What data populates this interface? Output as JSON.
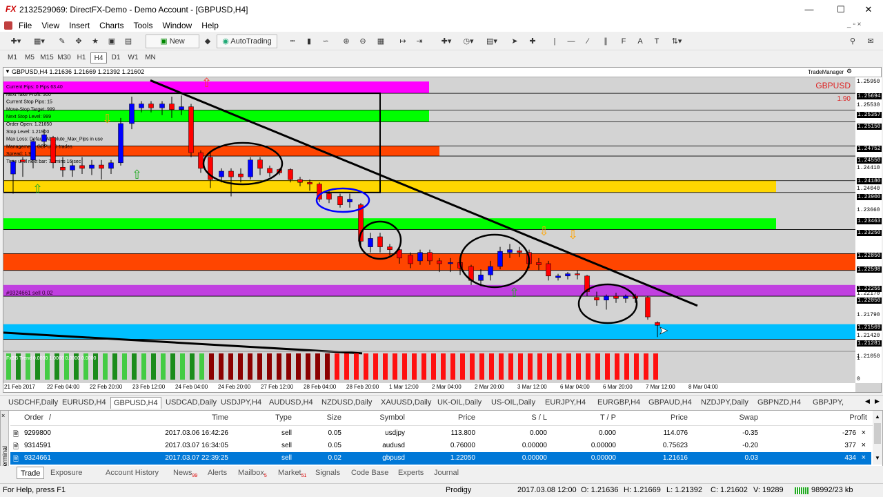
{
  "window": {
    "app_logo": "FX",
    "title": "2132529069: DirectFX-Demo - Demo Account - [GBPUSD,H4]"
  },
  "menu": [
    "File",
    "View",
    "Insert",
    "Charts",
    "Tools",
    "Window",
    "Help"
  ],
  "toolbar": {
    "new_order": "New Order",
    "auto_trading": "AutoTrading"
  },
  "timeframes": [
    "M1",
    "M5",
    "M15",
    "M30",
    "H1",
    "H4",
    "D1",
    "W1",
    "MN"
  ],
  "timeframe_selected": "H4",
  "chart": {
    "header": "GBPUSD,H4  1.21636 1.21669 1.21392 1.21602",
    "symbol_label": "GBPUSD",
    "spread_value": "1.90",
    "trade_manager": "TradeManager",
    "position_label": "#9324661 sell 0.02",
    "indicator_label": "FxBB Trend 0.0000 1.0000 0.0000 0.0000",
    "indicator_scale": [
      "1",
      "0"
    ],
    "overlay_lines": [
      "Current Pips: 0 Pips 63.40",
      "Next Take Profit: 300",
      "Current Stop Pips: 15",
      "Move-Stop Target: 999",
      "Next Stop Level: 999",
      "Order Open: 1.21650",
      "Stop Level: 1.21900",
      "Max Loss: Default Absolute_Max_Pips in use",
      "Management: GBPUSD trades",
      "Spread: 1.90",
      "Time until next bar: 78 mins 16 sec"
    ],
    "price_labels": [
      "1.25950",
      "1.25694",
      "1.25530",
      "1.25357",
      "1.25150",
      "1.24752",
      "1.24550",
      "1.24410",
      "1.24180",
      "1.24040",
      "1.23900",
      "1.23660",
      "1.23463",
      "1.23250",
      "1.22850",
      "1.22598",
      "1.22255",
      "1.22170",
      "1.22050",
      "1.21790",
      "1.21569",
      "1.21420",
      "1.21281",
      "1.21050"
    ],
    "time_labels": [
      "21 Feb 2017",
      "22 Feb 04:00",
      "22 Feb 20:00",
      "23 Feb 12:00",
      "24 Feb 04:00",
      "24 Feb 20:00",
      "27 Feb 12:00",
      "28 Feb 04:00",
      "28 Feb 20:00",
      "1 Mar 12:00",
      "2 Mar 04:00",
      "2 Mar 20:00",
      "3 Mar 12:00",
      "6 Mar 04:00",
      "6 Mar 20:00",
      "7 Mar 12:00",
      "8 Mar 04:00"
    ],
    "colors": {
      "magenta": "#ff00ff",
      "green": "#00ff00",
      "orange_red": "#ff4500",
      "gold": "#ffd700",
      "purple": "#c040e0",
      "cyan": "#00bfff",
      "bull": "#0000ff",
      "bear": "#ff0000",
      "bg": "#d3d3d3"
    }
  },
  "symbol_tabs": [
    "USDCHF,Daily",
    "EURUSD,H4",
    "GBPUSD,H4",
    "USDCAD,Daily",
    "USDJPY,H4",
    "AUDUSD,H4",
    "NZDUSD,Daily",
    "XAUUSD,Daily",
    "UK-OIL,Daily",
    "US-OIL,Daily",
    "EURJPY,H4",
    "EURGBP,H4",
    "GBPAUD,H4",
    "NZDJPY,Daily",
    "GBPNZD,H4",
    "GBPJPY,"
  ],
  "symbol_tab_selected": "GBPUSD,H4",
  "terminal": {
    "side_label": "Terminal",
    "columns": [
      "Order",
      "/",
      "Time",
      "Type",
      "Size",
      "Symbol",
      "Price",
      "S / L",
      "T / P",
      "Price",
      "Swap",
      "Profit"
    ],
    "rows": [
      {
        "order": "9299800",
        "time": "2017.03.06 16:42:26",
        "type": "sell",
        "size": "0.05",
        "symbol": "usdjpy",
        "price": "113.800",
        "sl": "0.000",
        "tp": "0.000",
        "cur": "114.076",
        "swap": "-0.35",
        "profit": "-276"
      },
      {
        "order": "9314591",
        "time": "2017.03.07 16:34:05",
        "type": "sell",
        "size": "0.05",
        "symbol": "audusd",
        "price": "0.76000",
        "sl": "0.00000",
        "tp": "0.00000",
        "cur": "0.75623",
        "swap": "-0.20",
        "profit": "377"
      },
      {
        "order": "9324661",
        "time": "2017.03.07 22:39:25",
        "type": "sell",
        "size": "0.02",
        "symbol": "gbpusd",
        "price": "1.22050",
        "sl": "0.00000",
        "tp": "0.00000",
        "cur": "1.21616",
        "swap": "0.03",
        "profit": "434"
      }
    ],
    "tabs": [
      "Trade",
      "Exposure",
      "Account History",
      "News",
      "Alerts",
      "Mailbox",
      "Market",
      "Signals",
      "Code Base",
      "Experts",
      "Journal"
    ],
    "tab_badges": {
      "News": "99",
      "Mailbox": "5",
      "Market": "51"
    },
    "tab_selected": "Trade"
  },
  "status": {
    "help": "For Help, press F1",
    "profile": "Prodigy",
    "datetime": "2017.03.08 12:00",
    "open": "O: 1.21636",
    "high": "H: 1.21669",
    "low": "L: 1.21392",
    "close": "C: 1.21602",
    "volume": "V: 19289",
    "traffic": "98992/23 kb"
  }
}
